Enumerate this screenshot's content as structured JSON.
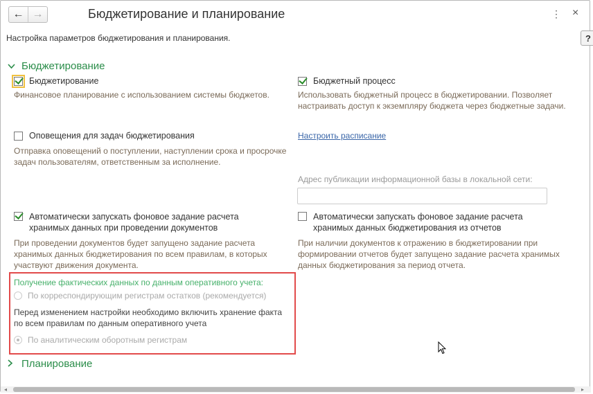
{
  "window": {
    "title": "Бюджетирование и планирование",
    "description": "Настройка параметров бюджетирования и планирования.",
    "back_icon": "←",
    "forward_icon": "→",
    "menu_icon": "⋮",
    "close_icon": "×",
    "help_label": "?"
  },
  "budgeting_section": {
    "title": "Бюджетирование",
    "budgeting": {
      "label": "Бюджетирование",
      "checked": true,
      "note": "Финансовое планирование с использованием системы бюджетов."
    },
    "budget_process": {
      "label": "Бюджетный процесс",
      "checked": true,
      "note": "Использовать бюджетный процесс в бюджетировании. Позволяет настраивать доступ к экземпляру бюджета через бюджетные задачи."
    },
    "task_notifications": {
      "label": "Оповещения для задач бюджетирования",
      "checked": false,
      "note": "Отправка оповещений о поступлении, наступлении срока и просрочке задач пользователям, ответственным за исполнение."
    },
    "schedule_link": "Настроить расписание",
    "publication_address": {
      "label": "Адрес публикации информационной базы в локальной сети:",
      "value": ""
    },
    "auto_start_docs": {
      "label": "Автоматически запускать фоновое задание расчета хранимых данных при проведении документов",
      "checked": true,
      "note": "При проведении документов будет запущено задание расчета хранимых данных бюджетирования по всем правилам, в которых участвуют движения документа."
    },
    "auto_start_reports": {
      "label": "Автоматически запускать фоновое задание расчета хранимых данных бюджетирования из отчетов",
      "checked": false,
      "note": "При наличии документов к отражению в бюджетировании при формировании отчетов будет запущено задание расчета хранимых данных бюджетирования за период отчета."
    },
    "actual_data": {
      "title": "Получение фактических данных по данным оперативного учета:",
      "option_correspondent": "По корреспондирующим регистрам остатков (рекомендуется)",
      "warning": "Перед изменением настройки необходимо включить хранение факта по всем правилам по данным оперативного учета",
      "option_analytic": "По аналитическим оборотным регистрам",
      "selected": "По аналитическим оборотным регистрам"
    }
  },
  "planning_section": {
    "title": "Планирование"
  },
  "scrollbar": {
    "left_icon": "◂",
    "right_icon": "▸"
  }
}
